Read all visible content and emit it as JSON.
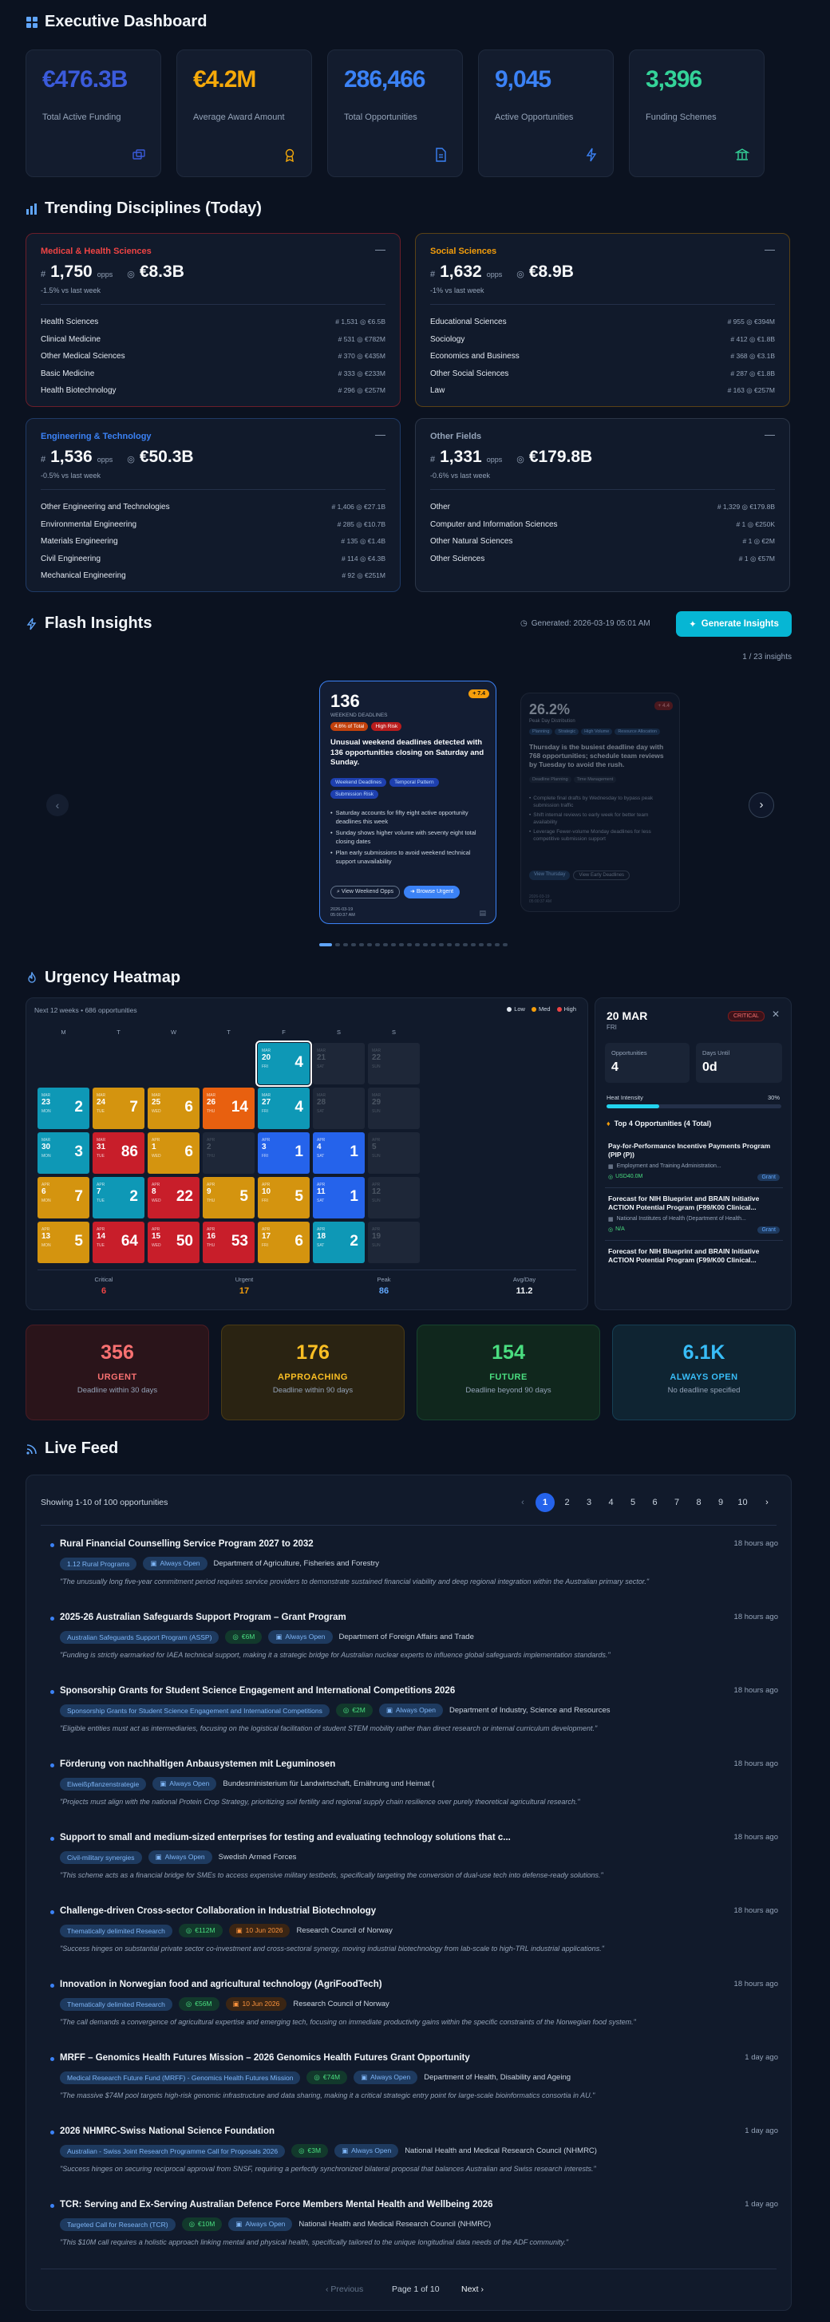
{
  "header": {
    "title": "Executive Dashboard"
  },
  "kpis": [
    {
      "value": "€476.3B",
      "label": "Total Active Funding",
      "color": "#3b5bdb",
      "icon": "bank-icon"
    },
    {
      "value": "€4.2M",
      "label": "Average Award Amount",
      "color": "#f5a90a",
      "icon": "award-icon"
    },
    {
      "value": "286,466",
      "label": "Total Opportunities",
      "color": "#3b82f6",
      "icon": "document-icon"
    },
    {
      "value": "9,045",
      "label": "Active Opportunities",
      "color": "#3b82f6",
      "icon": "bolt-icon"
    },
    {
      "value": "3,396",
      "label": "Funding Schemes",
      "color": "#34d399",
      "icon": "institution-icon"
    }
  ],
  "disciplines": {
    "title": "Trending Disciplines (Today)",
    "cards": [
      {
        "name": "Medical & Health Sciences",
        "color": "#ef4444",
        "border": "#6b1e2a",
        "count": "1,750",
        "unit": "opps",
        "amount": "€8.3B",
        "change": "-1.5% vs last week",
        "rows": [
          {
            "name": "Health Sciences",
            "stat": "# 1,531  ◎ €6.5B"
          },
          {
            "name": "Clinical Medicine",
            "stat": "# 531  ◎ €782M"
          },
          {
            "name": "Other Medical Sciences",
            "stat": "# 370  ◎ €435M"
          },
          {
            "name": "Basic Medicine",
            "stat": "# 333  ◎ €233M"
          },
          {
            "name": "Health Biotechnology",
            "stat": "# 296  ◎ €257M"
          }
        ]
      },
      {
        "name": "Social Sciences",
        "color": "#f59e0b",
        "border": "#5a4216",
        "count": "1,632",
        "unit": "opps",
        "amount": "€8.9B",
        "change": "-1% vs last week",
        "rows": [
          {
            "name": "Educational Sciences",
            "stat": "# 955  ◎ €394M"
          },
          {
            "name": "Sociology",
            "stat": "# 412  ◎ €1.8B"
          },
          {
            "name": "Economics and Business",
            "stat": "# 368  ◎ €3.1B"
          },
          {
            "name": "Other Social Sciences",
            "stat": "# 287  ◎ €1.8B"
          },
          {
            "name": "Law",
            "stat": "# 163  ◎ €257M"
          }
        ]
      },
      {
        "name": "Engineering & Technology",
        "color": "#3b82f6",
        "border": "#1f3a66",
        "count": "1,536",
        "unit": "opps",
        "amount": "€50.3B",
        "change": "-0.5% vs last week",
        "rows": [
          {
            "name": "Other Engineering and Technologies",
            "stat": "# 1,406  ◎ €27.1B"
          },
          {
            "name": "Environmental Engineering",
            "stat": "# 285  ◎ €10.7B"
          },
          {
            "name": "Materials Engineering",
            "stat": "# 135  ◎ €1.4B"
          },
          {
            "name": "Civil Engineering",
            "stat": "# 114  ◎ €4.3B"
          },
          {
            "name": "Mechanical Engineering",
            "stat": "# 92  ◎ €251M"
          }
        ]
      },
      {
        "name": "Other Fields",
        "color": "#94a3b8",
        "border": "#2b3547",
        "count": "1,331",
        "unit": "opps",
        "amount": "€179.8B",
        "change": "-0.6% vs last week",
        "rows": [
          {
            "name": "Other",
            "stat": "# 1,329  ◎ €179.8B"
          },
          {
            "name": "Computer and Information Sciences",
            "stat": "# 1  ◎ €250K"
          },
          {
            "name": "Other Natural Sciences",
            "stat": "# 1  ◎ €2M"
          },
          {
            "name": "Other Sciences",
            "stat": "# 1  ◎ €57M"
          }
        ]
      }
    ]
  },
  "insights": {
    "title": "Flash Insights",
    "generated": "Generated: 2026-03-19 05:01 AM",
    "button": "Generate Insights",
    "counter": "1 / 23 insights",
    "main": {
      "value": "136",
      "sublabel": "WEEKEND DEADLINES",
      "badge": "+ 7.4",
      "pill1": "4.6% of Total",
      "pill2": "High Risk",
      "headline": "Unusual weekend deadlines detected with 136 opportunities closing on Saturday and Sunday.",
      "tags": [
        "Weekend Deadlines",
        "Temporal Pattern",
        "Submission Risk"
      ],
      "bullets": [
        "Saturday accounts for fifty eight active opportunity deadlines this week",
        "Sunday shows higher volume with seventy eight total closing dates",
        "Plan early submissions to avoid weekend technical support unavailability"
      ],
      "btn1": "View Weekend Opps",
      "btn2": "Browse Urgent",
      "date": "2026-03-19",
      "time": "05:00:37 AM"
    },
    "side": {
      "value": "26.2%",
      "sublabel": "Peak Day Distribution",
      "badge": "+ 4.4",
      "headline": "Thursday is the busiest deadline day with 768 opportunities; schedule team reviews by Tuesday to avoid the rush.",
      "tags": [
        "Planning",
        "Strategic",
        "High Volume",
        "Resource Allocation"
      ],
      "tags2": [
        "Deadline Planning",
        "Time Management"
      ],
      "bullets": [
        "Complete final drafts by Wednesday to bypass peak submission traffic",
        "Shift internal reviews to early week for better team availability",
        "Leverage Fewer-volume Monday deadlines for less competitive submission support"
      ],
      "btn1": "View Thursday",
      "btn2": "View Early Deadlines",
      "date": "2026-03-19",
      "time": "05:00:37 AM"
    }
  },
  "heatmap": {
    "title": "Urgency Heatmap",
    "subtitle": "Next 12 weeks • 686 opportunities",
    "legend": [
      "Low",
      "Med",
      "High"
    ],
    "days": [
      "M",
      "T",
      "W",
      "T",
      "F",
      "S",
      "S"
    ],
    "weeks": [
      [
        null,
        null,
        null,
        null,
        {
          "m": "MAR",
          "d": "20",
          "w": "FRI",
          "c": "4",
          "k": "cyan",
          "sel": true
        },
        {
          "m": "MAR",
          "d": "21",
          "w": "SAT",
          "c": "",
          "k": "none"
        },
        {
          "m": "MAR",
          "d": "22",
          "w": "SUN",
          "c": "",
          "k": "none"
        }
      ],
      [
        {
          "m": "MAR",
          "d": "23",
          "w": "MON",
          "c": "2",
          "k": "cyan"
        },
        {
          "m": "MAR",
          "d": "24",
          "w": "TUE",
          "c": "7",
          "k": "amber"
        },
        {
          "m": "MAR",
          "d": "25",
          "w": "WED",
          "c": "6",
          "k": "amber"
        },
        {
          "m": "MAR",
          "d": "26",
          "w": "THU",
          "c": "14",
          "k": "orange"
        },
        {
          "m": "MAR",
          "d": "27",
          "w": "FRI",
          "c": "4",
          "k": "cyan"
        },
        {
          "m": "MAR",
          "d": "28",
          "w": "SAT",
          "c": "",
          "k": "none"
        },
        {
          "m": "MAR",
          "d": "29",
          "w": "SUN",
          "c": "",
          "k": "none"
        }
      ],
      [
        {
          "m": "MAR",
          "d": "30",
          "w": "MON",
          "c": "3",
          "k": "cyan"
        },
        {
          "m": "MAR",
          "d": "31",
          "w": "TUE",
          "c": "86",
          "k": "red"
        },
        {
          "m": "APR",
          "d": "1",
          "w": "WED",
          "c": "6",
          "k": "amber"
        },
        {
          "m": "APR",
          "d": "2",
          "w": "THU",
          "c": "",
          "k": "none"
        },
        {
          "m": "APR",
          "d": "3",
          "w": "FRI",
          "c": "1",
          "k": "blue"
        },
        {
          "m": "APR",
          "d": "4",
          "w": "SAT",
          "c": "1",
          "k": "blue"
        },
        {
          "m": "APR",
          "d": "5",
          "w": "SUN",
          "c": "",
          "k": "none"
        }
      ],
      [
        {
          "m": "APR",
          "d": "6",
          "w": "MON",
          "c": "7",
          "k": "amber"
        },
        {
          "m": "APR",
          "d": "7",
          "w": "TUE",
          "c": "2",
          "k": "cyan"
        },
        {
          "m": "APR",
          "d": "8",
          "w": "WED",
          "c": "22",
          "k": "red"
        },
        {
          "m": "APR",
          "d": "9",
          "w": "THU",
          "c": "5",
          "k": "amber"
        },
        {
          "m": "APR",
          "d": "10",
          "w": "FRI",
          "c": "5",
          "k": "amber"
        },
        {
          "m": "APR",
          "d": "11",
          "w": "SAT",
          "c": "1",
          "k": "blue"
        },
        {
          "m": "APR",
          "d": "12",
          "w": "SUN",
          "c": "",
          "k": "none"
        }
      ],
      [
        {
          "m": "APR",
          "d": "13",
          "w": "MON",
          "c": "5",
          "k": "amber"
        },
        {
          "m": "APR",
          "d": "14",
          "w": "TUE",
          "c": "64",
          "k": "red"
        },
        {
          "m": "APR",
          "d": "15",
          "w": "WED",
          "c": "50",
          "k": "red"
        },
        {
          "m": "APR",
          "d": "16",
          "w": "THU",
          "c": "53",
          "k": "red"
        },
        {
          "m": "APR",
          "d": "17",
          "w": "FRI",
          "c": "6",
          "k": "amber"
        },
        {
          "m": "APR",
          "d": "18",
          "w": "SAT",
          "c": "2",
          "k": "cyan"
        },
        {
          "m": "APR",
          "d": "19",
          "w": "SUN",
          "c": "",
          "k": "none"
        }
      ]
    ],
    "stats": [
      {
        "label": "Critical",
        "value": "6",
        "color": "#ef4444"
      },
      {
        "label": "Urgent",
        "value": "17",
        "color": "#f59e0b"
      },
      {
        "label": "Peak",
        "value": "86",
        "color": "#60a5fa"
      },
      {
        "label": "Avg/Day",
        "value": "11.2",
        "color": "#f1f5f9"
      }
    ],
    "detail": {
      "date": "20 MAR",
      "weekday": "FRI",
      "badge": "CRITICAL",
      "opp_label": "Opportunities",
      "opp": "4",
      "days_label": "Days Until",
      "days": "0d",
      "intensity_label": "Heat Intensity",
      "intensity": "30%",
      "intensity_value": 0.3,
      "top_title": "Top 4 Opportunities (4 Total)",
      "items": [
        {
          "title": "Pay-for-Performance Incentive Payments Program (PIP (P))",
          "agency": "Employment and Training Administration...",
          "amount": "USD40.0M",
          "type": "Grant"
        },
        {
          "title": "Forecast for NIH Blueprint and BRAIN Initiative ACTION Potential Program (F99/K00 Clinical...",
          "agency": "National Institutes of Health (Department of Health...",
          "amount": "N/A",
          "type": "Grant"
        },
        {
          "title": "Forecast for NIH Blueprint and BRAIN Initiative ACTION Potential Program (F99/K00 Clinical...",
          "agency": "",
          "amount": "",
          "type": ""
        }
      ]
    }
  },
  "summary": [
    {
      "value": "356",
      "title": "URGENT",
      "desc": "Deadline within 30 days",
      "color": "#f87171",
      "bg": "#2a141a",
      "border": "#4a1c24"
    },
    {
      "value": "176",
      "title": "APPROACHING",
      "desc": "Deadline within 90 days",
      "color": "#fbbf24",
      "bg": "#2a2312",
      "border": "#4a3b15"
    },
    {
      "value": "154",
      "title": "FUTURE",
      "desc": "Deadline beyond 90 days",
      "color": "#4ade80",
      "bg": "#10271d",
      "border": "#17432e"
    },
    {
      "value": "6.1K",
      "title": "ALWAYS OPEN",
      "desc": "No deadline specified",
      "color": "#38bdf8",
      "bg": "#0f2432",
      "border": "#163f54"
    }
  ],
  "feed": {
    "title": "Live Feed",
    "showing": "Showing 1-10 of 100 opportunities",
    "pages": [
      "1",
      "2",
      "3",
      "4",
      "5",
      "6",
      "7",
      "8",
      "9",
      "10"
    ],
    "prev": "Previous",
    "page_info": "Page 1 of 10",
    "next": "Next",
    "items": [
      {
        "title": "Rural Financial Counselling Service Program 2027 to 2032",
        "time": "18 hours ago",
        "tags": [
          {
            "t": "1.12 Rural Programs",
            "k": "b"
          },
          {
            "t": "Always Open",
            "k": "b",
            "i": "▣"
          }
        ],
        "agency": "Department of Agriculture, Fisheries and Forestry",
        "quote": "\"The unusually long five-year commitment period requires service providers to demonstrate sustained financial viability and deep regional integration within the Australian primary sector.\""
      },
      {
        "title": "2025-26 Australian Safeguards Support Program – Grant Program",
        "time": "18 hours ago",
        "tags": [
          {
            "t": "Australian Safeguards Support Program (ASSP)",
            "k": "b"
          },
          {
            "t": "€6M",
            "k": "g",
            "i": "◎"
          },
          {
            "t": "Always Open",
            "k": "b",
            "i": "▣"
          }
        ],
        "agency": "Department of Foreign Affairs and Trade",
        "quote": "\"Funding is strictly earmarked for IAEA technical support, making it a strategic bridge for Australian nuclear experts to influence global safeguards implementation standards.\""
      },
      {
        "title": "Sponsorship Grants for Student Science Engagement and International Competitions 2026",
        "time": "18 hours ago",
        "tags": [
          {
            "t": "Sponsorship Grants for Student Science Engagement and International Competitions",
            "k": "b"
          },
          {
            "t": "€2M",
            "k": "g",
            "i": "◎"
          },
          {
            "t": "Always Open",
            "k": "b",
            "i": "▣"
          }
        ],
        "agency": "Department of Industry, Science and Resources",
        "quote": "\"Eligible entities must act as intermediaries, focusing on the logistical facilitation of student STEM mobility rather than direct research or internal curriculum development.\""
      },
      {
        "title": "Förderung von nachhaltigen Anbausystemen mit Leguminosen",
        "time": "18 hours ago",
        "tags": [
          {
            "t": "Eiweißpflanzenstrategie",
            "k": "b"
          },
          {
            "t": "Always Open",
            "k": "b",
            "i": "▣"
          }
        ],
        "agency": "Bundesministerium für Landwirtschaft, Ernährung und Heimat (",
        "quote": "\"Projects must align with the national Protein Crop Strategy, prioritizing soil fertility and regional supply chain resilience over purely theoretical agricultural research.\""
      },
      {
        "title": "Support to small and medium-sized enterprises for testing and evaluating technology solutions that c...",
        "time": "18 hours ago",
        "tags": [
          {
            "t": "Civil-military synergies",
            "k": "b"
          },
          {
            "t": "Always Open",
            "k": "b",
            "i": "▣"
          }
        ],
        "agency": "Swedish Armed Forces",
        "quote": "\"This scheme acts as a financial bridge for SMEs to access expensive military testbeds, specifically targeting the conversion of dual-use tech into defense-ready solutions.\""
      },
      {
        "title": "Challenge-driven Cross-sector Collaboration in Industrial Biotechnology",
        "time": "18 hours ago",
        "tags": [
          {
            "t": "Thematically delimited Research",
            "k": "b"
          },
          {
            "t": "€112M",
            "k": "g",
            "i": "◎"
          },
          {
            "t": "10 Jun 2026",
            "k": "o",
            "i": "▣"
          }
        ],
        "agency": "Research Council of Norway",
        "quote": "\"Success hinges on substantial private sector co-investment and cross-sectoral synergy, moving industrial biotechnology from lab-scale to high-TRL industrial applications.\""
      },
      {
        "title": "Innovation in Norwegian food and agricultural technology (AgriFoodTech)",
        "time": "18 hours ago",
        "tags": [
          {
            "t": "Thematically delimited Research",
            "k": "b"
          },
          {
            "t": "€56M",
            "k": "g",
            "i": "◎"
          },
          {
            "t": "10 Jun 2026",
            "k": "o",
            "i": "▣"
          }
        ],
        "agency": "Research Council of Norway",
        "quote": "\"The call demands a convergence of agricultural expertise and emerging tech, focusing on immediate productivity gains within the specific constraints of the Norwegian food system.\""
      },
      {
        "title": "MRFF – Genomics Health Futures Mission – 2026 Genomics Health Futures Grant Opportunity",
        "time": "1 day ago",
        "tags": [
          {
            "t": "Medical Research Future Fund (MRFF) - Genomics Health Futures Mission",
            "k": "b"
          },
          {
            "t": "€74M",
            "k": "g",
            "i": "◎"
          },
          {
            "t": "Always Open",
            "k": "b",
            "i": "▣"
          }
        ],
        "agency": "Department of Health, Disability and Ageing",
        "quote": "\"The massive $74M pool targets high-risk genomic infrastructure and data sharing, making it a critical strategic entry point for large-scale bioinformatics consortia in AU.\""
      },
      {
        "title": "2026 NHMRC-Swiss National Science Foundation",
        "time": "1 day ago",
        "tags": [
          {
            "t": "Australian - Swiss Joint Research Programme Call for Proposals 2026",
            "k": "b"
          },
          {
            "t": "€3M",
            "k": "g",
            "i": "◎"
          },
          {
            "t": "Always Open",
            "k": "b",
            "i": "▣"
          }
        ],
        "agency": "National Health and Medical Research Council (NHMRC)",
        "quote": "\"Success hinges on securing reciprocal approval from SNSF, requiring a perfectly synchronized bilateral proposal that balances Australian and Swiss research interests.\""
      },
      {
        "title": "TCR: Serving and Ex-Serving Australian Defence Force Members Mental Health and Wellbeing 2026",
        "time": "1 day ago",
        "tags": [
          {
            "t": "Targeted Call for Research (TCR)",
            "k": "b"
          },
          {
            "t": "€10M",
            "k": "g",
            "i": "◎"
          },
          {
            "t": "Always Open",
            "k": "b",
            "i": "▣"
          }
        ],
        "agency": "National Health and Medical Research Council (NHMRC)",
        "quote": "\"This $10M call requires a holistic approach linking mental and physical health, specifically tailored to the unique longitudinal data needs of the ADF community.\""
      }
    ]
  },
  "colors": {
    "cyan": "#0e98b6",
    "amber": "#d4940f",
    "orange": "#e8600f",
    "red": "#c81e2a",
    "blue": "#2563eb",
    "none": "#1e2738"
  }
}
